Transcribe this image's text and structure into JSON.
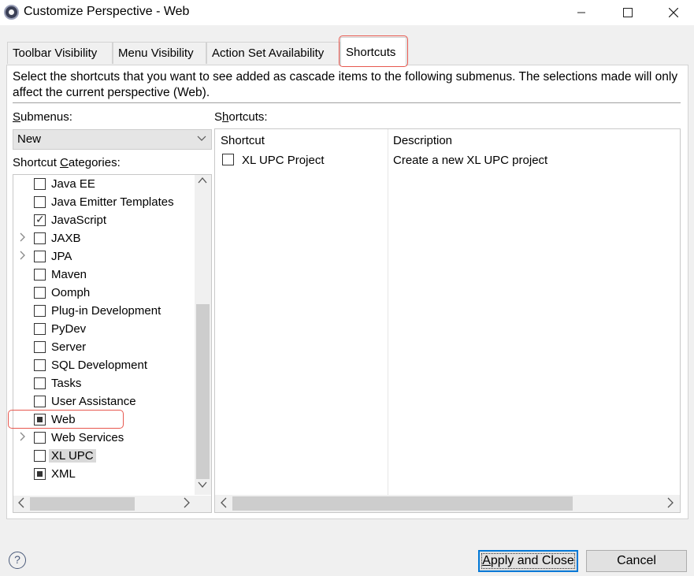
{
  "window": {
    "title": "Customize Perspective - Web",
    "icon": "eclipse-app-icon",
    "controls": [
      "minimize-icon",
      "maximize-icon",
      "close-icon"
    ]
  },
  "tabs": [
    {
      "label": "Toolbar Visibility",
      "selected": false
    },
    {
      "label": "Menu Visibility",
      "selected": false
    },
    {
      "label": "Action Set Availability",
      "selected": false
    },
    {
      "label": "Shortcuts",
      "selected": true
    }
  ],
  "description": "Select the shortcuts that you want to see added as cascade items to the following submenus. The selections made will only affect the current perspective (Web).",
  "submenus": {
    "label_mnemonic": "S",
    "label_rest": "ubmenus:",
    "selected": "New"
  },
  "categories": {
    "label_prefix": "Shortcut ",
    "label_mnemonic": "C",
    "label_rest": "ategories:",
    "items": [
      {
        "label": "Java EE",
        "state": "unchecked",
        "expandable": false,
        "selected": false
      },
      {
        "label": "Java Emitter Templates",
        "state": "unchecked",
        "expandable": false,
        "selected": false
      },
      {
        "label": "JavaScript",
        "state": "checked",
        "expandable": false,
        "selected": false
      },
      {
        "label": "JAXB",
        "state": "unchecked",
        "expandable": true,
        "selected": false
      },
      {
        "label": "JPA",
        "state": "unchecked",
        "expandable": true,
        "selected": false
      },
      {
        "label": "Maven",
        "state": "unchecked",
        "expandable": false,
        "selected": false
      },
      {
        "label": "Oomph",
        "state": "unchecked",
        "expandable": false,
        "selected": false
      },
      {
        "label": "Plug-in Development",
        "state": "unchecked",
        "expandable": false,
        "selected": false
      },
      {
        "label": "PyDev",
        "state": "unchecked",
        "expandable": false,
        "selected": false
      },
      {
        "label": "Server",
        "state": "unchecked",
        "expandable": false,
        "selected": false
      },
      {
        "label": "SQL Development",
        "state": "unchecked",
        "expandable": false,
        "selected": false
      },
      {
        "label": "Tasks",
        "state": "unchecked",
        "expandable": false,
        "selected": false
      },
      {
        "label": "User Assistance",
        "state": "unchecked",
        "expandable": false,
        "selected": false
      },
      {
        "label": "Web",
        "state": "partial",
        "expandable": false,
        "selected": false
      },
      {
        "label": "Web Services",
        "state": "unchecked",
        "expandable": true,
        "selected": false
      },
      {
        "label": "XL UPC",
        "state": "unchecked",
        "expandable": false,
        "selected": true
      },
      {
        "label": "XML",
        "state": "partial",
        "expandable": false,
        "selected": false
      }
    ]
  },
  "shortcuts": {
    "label_prefix": "S",
    "label_mnemonic": "h",
    "label_rest": "ortcuts:",
    "columns": [
      "Shortcut",
      "Description"
    ],
    "rows": [
      {
        "name": "XL UPC Project",
        "description": "Create a new XL UPC project",
        "checked": false
      }
    ]
  },
  "buttons": {
    "apply_mnemonic": "A",
    "apply_rest": "pply and Close",
    "cancel": "Cancel"
  },
  "colors": {
    "highlight": "#e7584f",
    "default_button_border": "#0078d7"
  }
}
